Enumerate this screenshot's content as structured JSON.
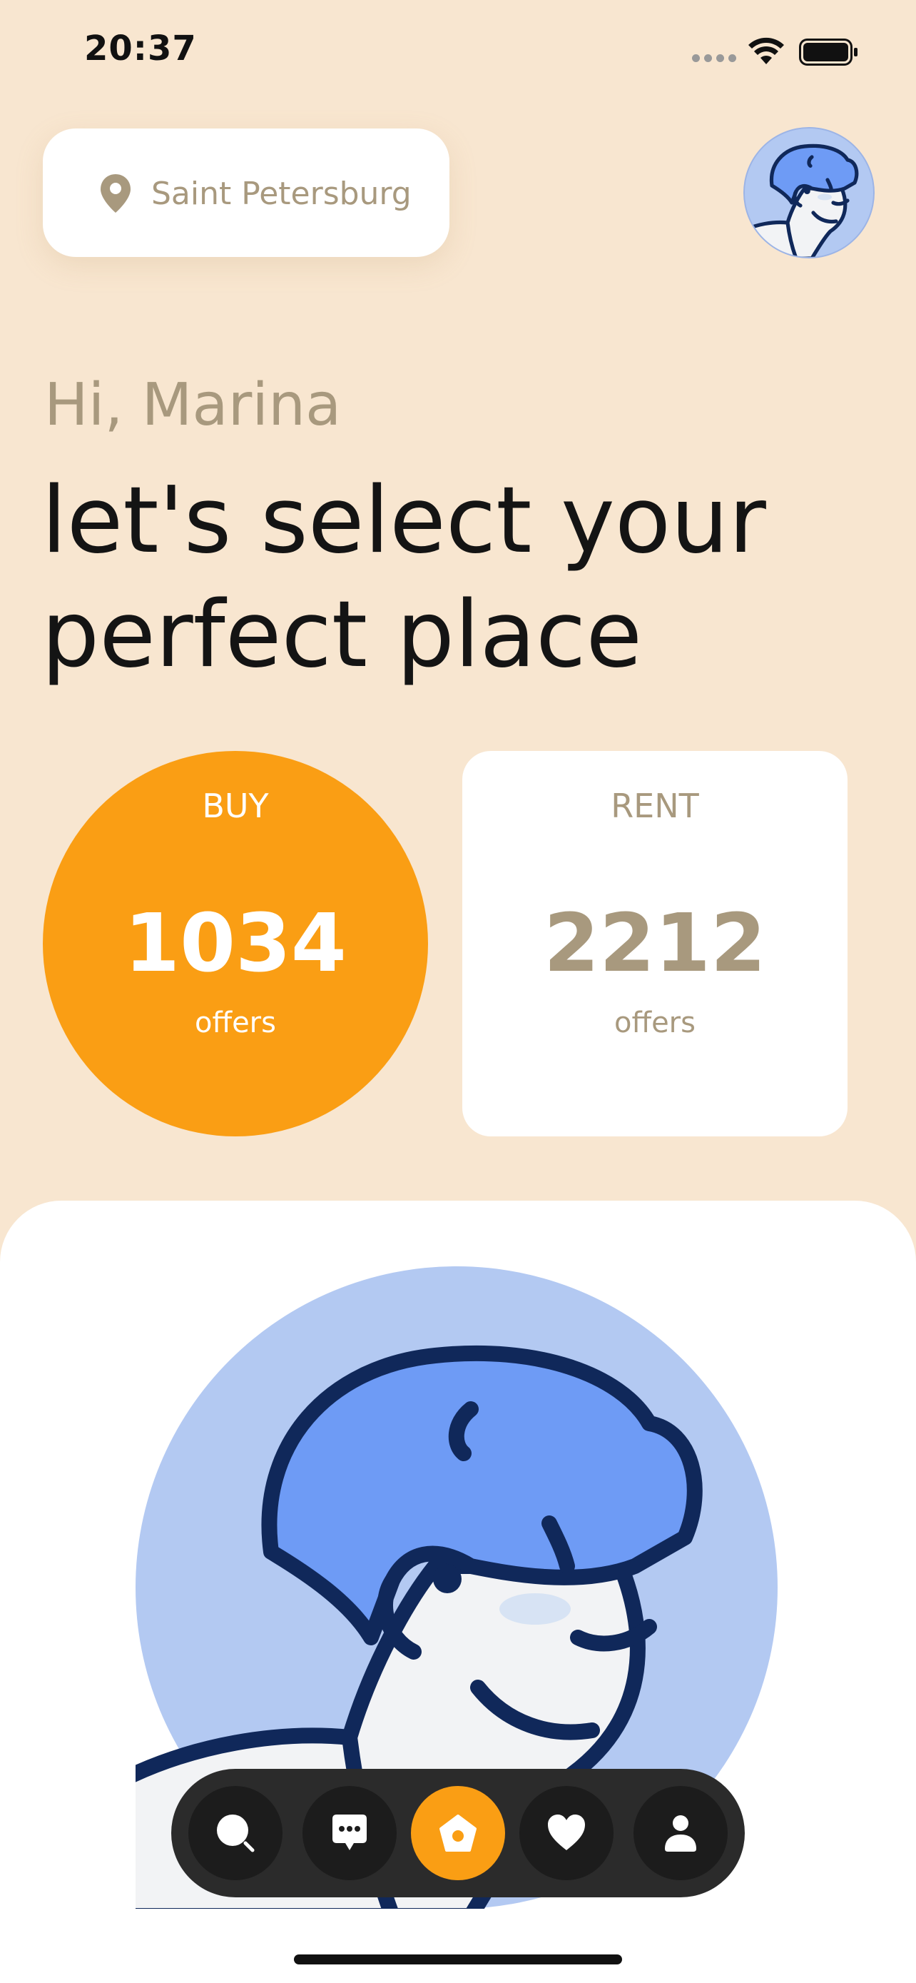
{
  "status_bar": {
    "time": "20:37"
  },
  "location": {
    "city": "Saint Petersburg",
    "icon": "location-pin-icon"
  },
  "greeting": {
    "hello": "Hi, Marina",
    "headline": "let's select your perfect place"
  },
  "cards": {
    "buy": {
      "title": "BUY",
      "count": "1034",
      "unit": "offers"
    },
    "rent": {
      "title": "RENT",
      "count": "2212",
      "unit": "offers"
    }
  },
  "tab_bar": {
    "items": [
      {
        "icon": "search-icon",
        "active": false
      },
      {
        "icon": "chat-icon",
        "active": false
      },
      {
        "icon": "home-icon",
        "active": true
      },
      {
        "icon": "heart-icon",
        "active": false
      },
      {
        "icon": "profile-icon",
        "active": false
      }
    ]
  },
  "colors": {
    "background": "#F8E6D0",
    "accent": "#FA9E14",
    "muted_text": "#A8997E",
    "tab_bar": "#2B2B2B",
    "avatar_bg": "#B3C9F2"
  }
}
